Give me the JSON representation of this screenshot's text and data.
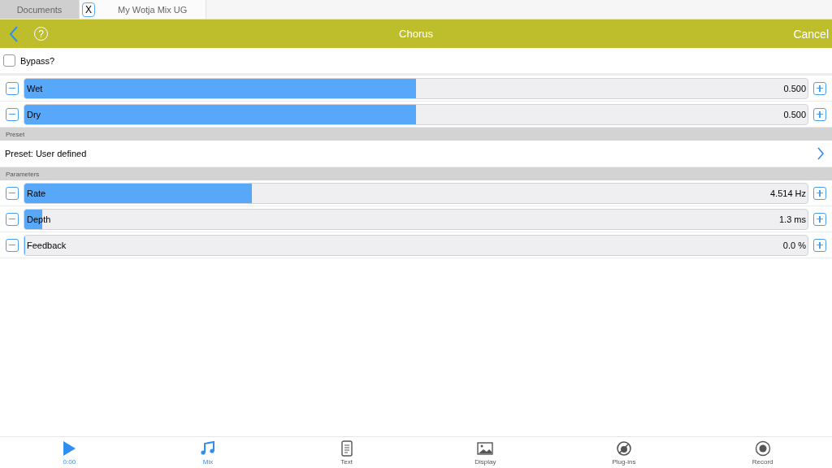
{
  "tabs": [
    {
      "label": "Documents",
      "selected": false
    },
    {
      "icon_label": "X",
      "label": "My Wotja Mix UG",
      "selected": true
    }
  ],
  "header": {
    "title": "Chorus",
    "help": "?",
    "cancel": "Cancel"
  },
  "bypass": {
    "label": "Bypass?",
    "checked": false
  },
  "mix_sliders": [
    {
      "name": "Wet",
      "level": 0.5,
      "reading": "0.500"
    },
    {
      "name": "Dry",
      "level": 0.5,
      "reading": "0.500"
    }
  ],
  "preset_section": {
    "title": "Preset",
    "value": "Preset: User defined"
  },
  "parameters_section": {
    "title": "Parameters",
    "sliders": [
      {
        "name": "Rate",
        "level": 0.29,
        "reading": "4.514 Hz"
      },
      {
        "name": "Depth",
        "level": 0.023,
        "reading": "1.3 ms"
      },
      {
        "name": "Feedback",
        "level": 0,
        "reading": "0.0 %"
      }
    ]
  },
  "toolbar": [
    {
      "kind": "play",
      "label": "0:00",
      "selected": true
    },
    {
      "kind": "mix",
      "label": "Mix",
      "selected": true
    },
    {
      "kind": "text",
      "label": "Text",
      "selected": false
    },
    {
      "kind": "display",
      "label": "Display",
      "selected": false
    },
    {
      "kind": "plugins",
      "label": "Plug-ins",
      "selected": false
    },
    {
      "kind": "record",
      "label": "Record",
      "selected": false
    }
  ]
}
